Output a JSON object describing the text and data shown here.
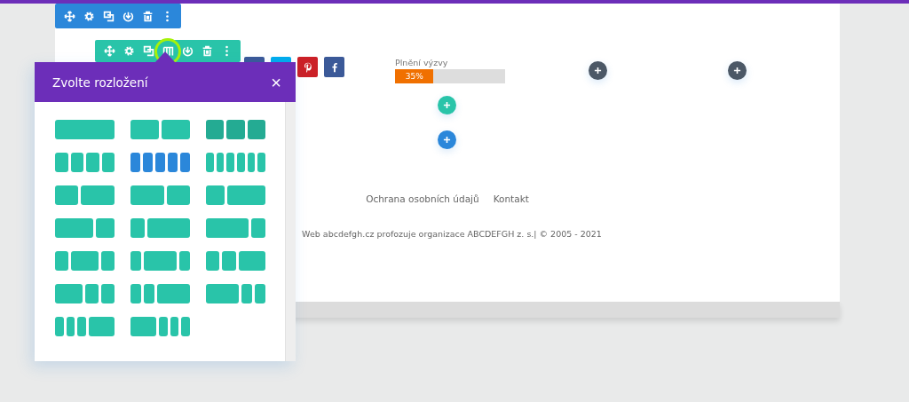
{
  "toolbars": [
    {
      "color": "#2b87da",
      "tools": [
        {
          "kind": "move",
          "highlighted": false
        },
        {
          "kind": "settings",
          "highlighted": false
        },
        {
          "kind": "duplicate",
          "highlighted": false
        },
        {
          "kind": "save",
          "highlighted": false
        },
        {
          "kind": "delete",
          "highlighted": false
        },
        {
          "kind": "more",
          "highlighted": false
        }
      ]
    },
    {
      "color": "#29c4a9",
      "tools": [
        {
          "kind": "move",
          "highlighted": false
        },
        {
          "kind": "settings",
          "highlighted": false
        },
        {
          "kind": "duplicate",
          "highlighted": false
        },
        {
          "kind": "columns",
          "highlighted": true
        },
        {
          "kind": "save",
          "highlighted": false
        },
        {
          "kind": "delete",
          "highlighted": false
        },
        {
          "kind": "more",
          "highlighted": false
        }
      ]
    }
  ],
  "social": [
    {
      "kind": "share",
      "color": "#3b5998"
    },
    {
      "kind": "twitter",
      "color": "#00aced"
    },
    {
      "kind": "pinterest",
      "color": "#cb2027"
    },
    {
      "kind": "facebook",
      "color": "#3b5998"
    }
  ],
  "progress": {
    "title": "Plnění výzvy",
    "level": 0.35,
    "reading": "35%"
  },
  "add_buttons": [
    {
      "color": "#4c5866"
    },
    {
      "color": "#4c5866"
    },
    {
      "color": "#29c4a9"
    },
    {
      "color": "#2b87da"
    }
  ],
  "footer": {
    "links": [
      "Ochrana osobních údajů",
      "Kontakt"
    ],
    "copyright": "Web abcdefgh.cz profozuje organizace ABCDEFGH z. s.| © 2005 - 2021"
  },
  "modal": {
    "title": "Zvolte rozložení",
    "close": "×",
    "layouts": [
      {
        "kind": "full",
        "selected": false,
        "hovered": false
      },
      {
        "kind": "halves",
        "selected": false,
        "hovered": false
      },
      {
        "kind": "thirds",
        "selected": false,
        "hovered": true
      },
      {
        "kind": "quarters",
        "selected": false,
        "hovered": false
      },
      {
        "kind": "fifths",
        "selected": true,
        "hovered": false
      },
      {
        "kind": "sixths",
        "selected": false,
        "hovered": false
      },
      {
        "kind": "twofifths_threefifths",
        "selected": false,
        "hovered": false
      },
      {
        "kind": "threefifths_twofifths",
        "selected": false,
        "hovered": false
      },
      {
        "kind": "third_twothirds",
        "selected": false,
        "hovered": false
      },
      {
        "kind": "twothirds_third",
        "selected": false,
        "hovered": false
      },
      {
        "kind": "quarter_threequarters",
        "selected": false,
        "hovered": false
      },
      {
        "kind": "threequarters_quarter",
        "selected": false,
        "hovered": false
      },
      {
        "kind": "quarter_half_quarter",
        "selected": false,
        "hovered": false
      },
      {
        "kind": "fifth_threefifths_fifth",
        "selected": false,
        "hovered": false
      },
      {
        "kind": "quarter_quarter_half",
        "selected": false,
        "hovered": false
      },
      {
        "kind": "half_quarter_quarter",
        "selected": false,
        "hovered": false
      },
      {
        "kind": "fifth_fifth_threefifths",
        "selected": false,
        "hovered": false
      },
      {
        "kind": "threefifths_fifth_fifth",
        "selected": false,
        "hovered": false
      },
      {
        "kind": "sixth_sixth_sixth_half",
        "selected": false,
        "hovered": false
      },
      {
        "kind": "half_sixth_sixth_sixth",
        "selected": false,
        "hovered": false
      }
    ]
  }
}
